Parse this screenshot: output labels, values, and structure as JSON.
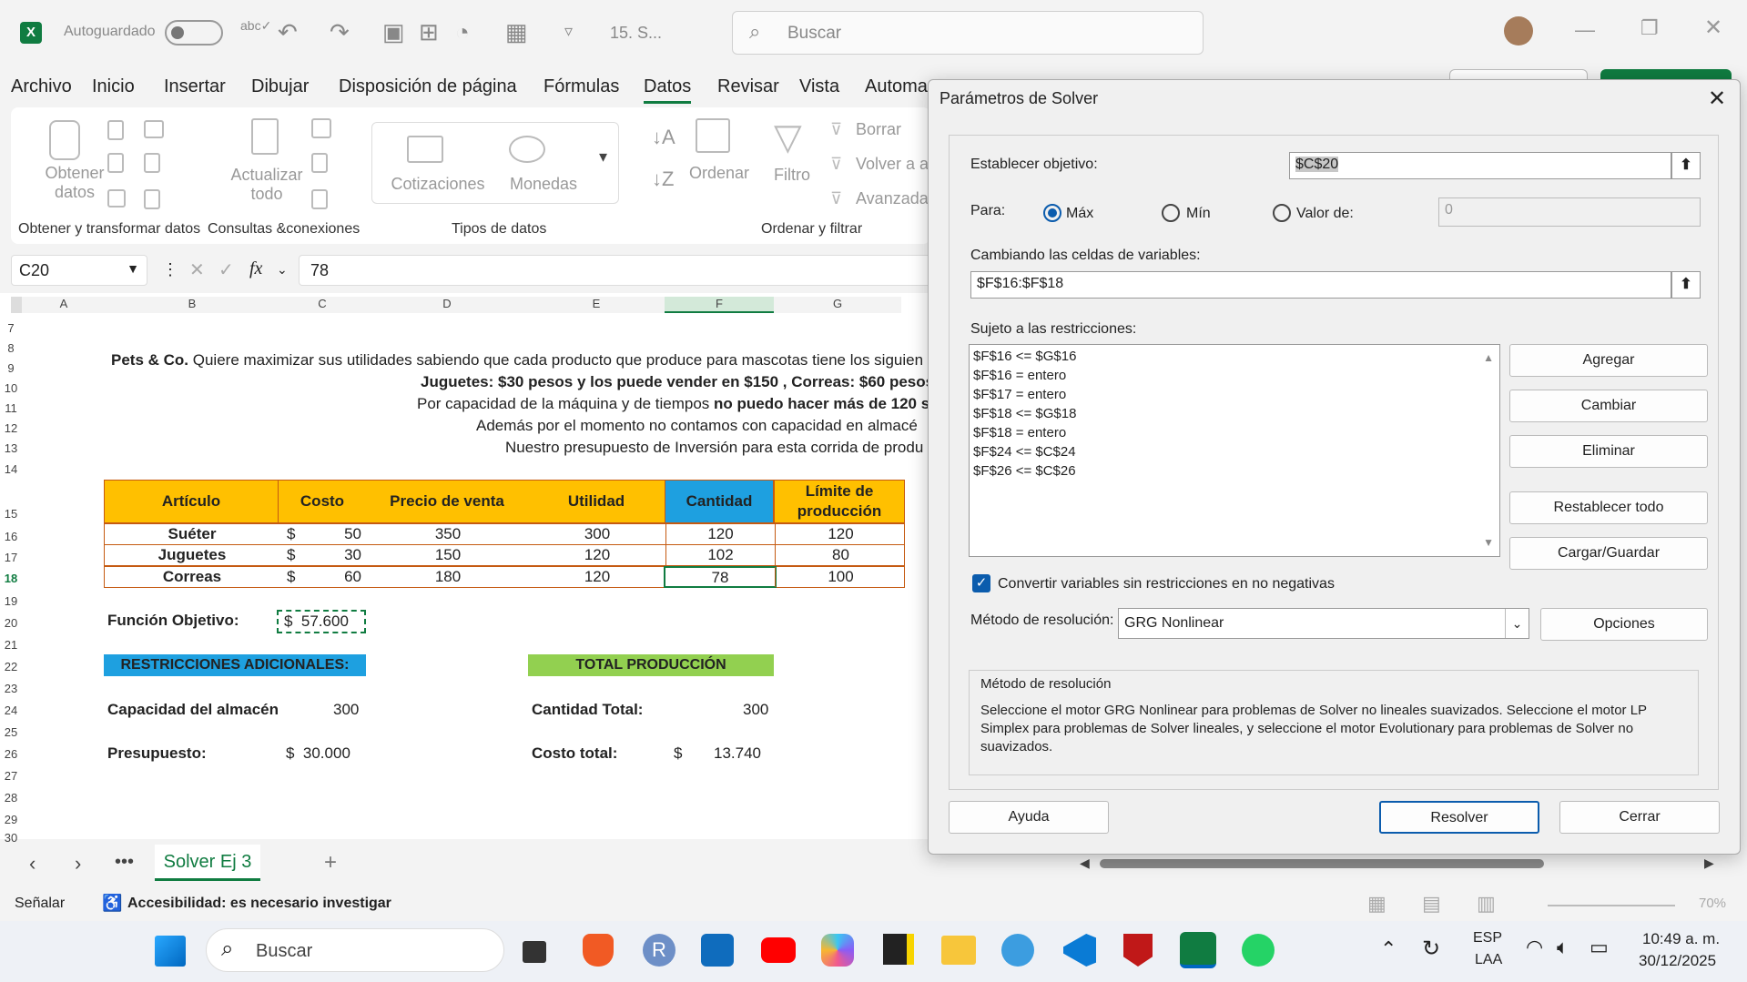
{
  "titlebar": {
    "autosave_label": "Autoguardado",
    "filename": "15. S...",
    "search_placeholder": "Buscar"
  },
  "menu": [
    "Archivo",
    "Inicio",
    "Insertar",
    "Dibujar",
    "Disposición de página",
    "Fórmulas",
    "Datos",
    "Revisar",
    "Vista",
    "Automa"
  ],
  "ribbon": {
    "obtener_datos": "Obtener datos",
    "obtener_transformar": "Obtener y transformar datos",
    "actualizar_todo": "Actualizar todo",
    "consultas": "Consultas &conexiones",
    "cotizaciones": "Cotizaciones",
    "monedas": "Monedas",
    "tipos_datos": "Tipos de datos",
    "ordenar": "Ordenar",
    "filtro": "Filtro",
    "borrar": "Borrar",
    "volver": "Volver a a",
    "avanzadas": "Avanzada",
    "ordenar_filtrar": "Ordenar y filtrar"
  },
  "formula_bar": {
    "cell_ref": "C20",
    "value": "78",
    "fx": "fx"
  },
  "columns": [
    "A",
    "B",
    "C",
    "D",
    "E",
    "F",
    "G"
  ],
  "rows": [
    "7",
    "8",
    "9",
    "10",
    "11",
    "12",
    "13",
    "14",
    "15",
    "16",
    "17",
    "18",
    "19",
    "20",
    "21",
    "22",
    "23",
    "24",
    "25",
    "26",
    "27",
    "28",
    "29",
    "30"
  ],
  "sheet": {
    "line9_bold": "Pets & Co.",
    "line9": " Quiere maximizar sus utilidades sabiendo que cada producto que produce para mascotas tiene los siguien",
    "line10": "Juguetes: $30 pesos y los puede vender en $150 , Correas: $60 pesos",
    "line11a": "Por capacidad de la máquina y de tiempos ",
    "line11b": "no puedo hacer más de 120 s",
    "line12": "Además por el momento no contamos con capacidad en almacé",
    "line13": "Nuestro presupuesto de Inversión para esta corrida de produ",
    "table_headers": [
      "Artículo",
      "Costo",
      "Precio de venta",
      "Utilidad",
      "Cantidad",
      "Límite de producción"
    ],
    "table_rows": [
      [
        "Suéter",
        "$",
        "50",
        "350",
        "300",
        "120",
        "120"
      ],
      [
        "Juguetes",
        "$",
        "30",
        "150",
        "120",
        "102",
        "80"
      ],
      [
        "Correas",
        "$",
        "60",
        "180",
        "120",
        "78",
        "100"
      ]
    ],
    "funcion_objetivo_label": "Función Objetivo:",
    "funcion_objetivo_value": "$  57.600",
    "restricciones_label": "RESTRICCIONES ADICIONALES:",
    "total_produccion_label": "TOTAL PRODUCCIÓN",
    "capacidad_label": "Capacidad del almacén",
    "capacidad_value": "300",
    "presupuesto_label": "Presupuesto:",
    "presupuesto_value": "$  30.000",
    "cantidad_total_label": "Cantidad Total:",
    "cantidad_total_value": "300",
    "costo_total_label": "Costo total:",
    "costo_total_dollar": "$",
    "costo_total_value": "13.740"
  },
  "sheet_tab": "Solver Ej 3",
  "status": {
    "left": "Señalar",
    "accessibility": "Accesibilidad: es necesario investigar",
    "zoom": "70%"
  },
  "dialog": {
    "title": "Parámetros de Solver",
    "objetivo_label": "Establecer objetivo:",
    "objetivo_value": "$C$20",
    "para_label": "Para:",
    "max_label": "Máx",
    "min_label": "Mín",
    "valor_label": "Valor de:",
    "valor_value": "0",
    "cambiando_label": "Cambiando las celdas de variables:",
    "cambiando_value": "$F$16:$F$18",
    "sujeto_label": "Sujeto a las restricciones:",
    "constraints": [
      "$F$16 <= $G$16",
      "$F$16 = entero",
      "$F$17 = entero",
      "$F$18 <= $G$18",
      "$F$18 = entero",
      "$F$24 <= $C$24",
      "$F$26 <= $C$26"
    ],
    "btn_agregar": "Agregar",
    "btn_cambiar": "Cambiar",
    "btn_eliminar": "Eliminar",
    "btn_restablecer": "Restablecer todo",
    "btn_cargar": "Cargar/Guardar",
    "convertir_label": "Convertir variables sin restricciones en no negativas",
    "metodo_label": "Método de resolución:",
    "metodo_value": "GRG Nonlinear",
    "btn_opciones": "Opciones",
    "group_title": "Método de resolución",
    "description": "Seleccione el motor GRG Nonlinear para problemas de Solver no lineales suavizados. Seleccione el motor LP Simplex para problemas de Solver lineales, y seleccione el motor Evolutionary para problemas de Solver no suavizados.",
    "btn_ayuda": "Ayuda",
    "btn_resolver": "Resolver",
    "btn_cerrar": "Cerrar"
  },
  "taskbar": {
    "search": "Buscar",
    "lang1": "ESP",
    "lang2": "LAA",
    "time": "10:49 a. m.",
    "date": "30/12/2025"
  }
}
